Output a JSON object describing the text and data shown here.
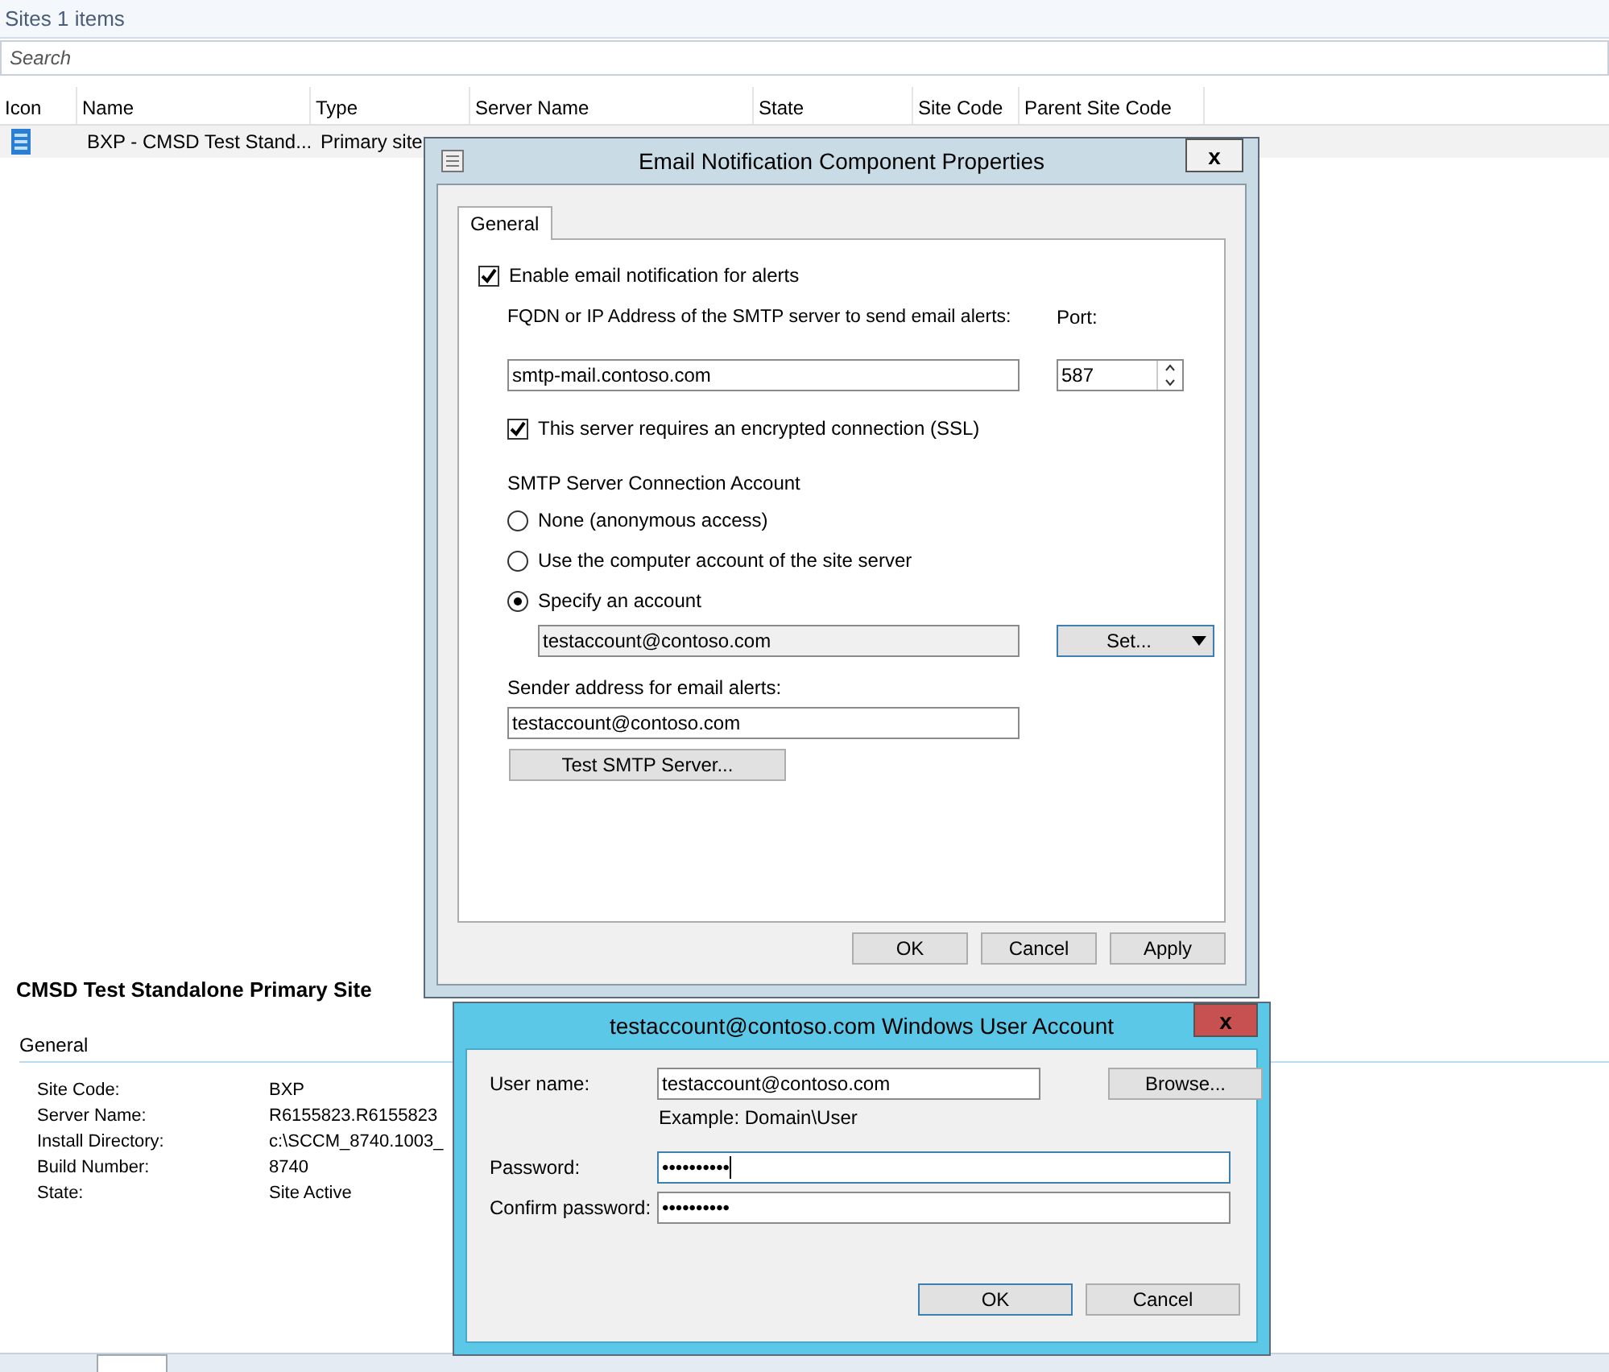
{
  "list_view": {
    "title": "Sites 1 items",
    "search": {
      "placeholder": "Search"
    },
    "columns": [
      "Icon",
      "Name",
      "Type",
      "Server Name",
      "State",
      "Site Code",
      "Parent Site Code"
    ],
    "rows": [
      {
        "cells": [
          "",
          "BXP - CMSD Test Stand...",
          "Primary site"
        ]
      }
    ]
  },
  "details": {
    "title": "CMSD Test Standalone Primary Site",
    "section": "General",
    "properties": [
      {
        "label": "Site Code:",
        "value": "BXP"
      },
      {
        "label": "Server Name:",
        "value": "R6155823.R6155823"
      },
      {
        "label": "Install Directory:",
        "value": "c:\\SCCM_8740.1003_"
      },
      {
        "label": "Build Number:",
        "value": "8740"
      },
      {
        "label": "State:",
        "value": "Site Active"
      }
    ]
  },
  "email_dialog": {
    "title": "Email Notification Component Properties",
    "close": "x",
    "tabs": [
      {
        "label": "General",
        "selected": true
      }
    ],
    "enable_checkbox": {
      "label": "Enable email notification for alerts",
      "checked": true
    },
    "server_label": "FQDN or IP Address of the SMTP server to send email alerts:",
    "port_label": "Port:",
    "server": "smtp-mail.contoso.com",
    "port": "587",
    "ssl_checkbox": {
      "label": "This server requires an encrypted connection (SSL)",
      "checked": true
    },
    "account_heading": "SMTP Server Connection Account",
    "account_options": [
      {
        "label": "None (anonymous access)",
        "selected": false
      },
      {
        "label": "Use the computer account of the site server",
        "selected": false
      },
      {
        "label": "Specify an account",
        "selected": true
      }
    ],
    "account": "testaccount@contoso.com",
    "set_button": "Set...",
    "sender_label": "Sender address for email alerts:",
    "sender": "testaccount@contoso.com",
    "test_button": "Test SMTP Server...",
    "buttons": [
      "OK",
      "Cancel",
      "Apply"
    ]
  },
  "account_dialog": {
    "title": "testaccount@contoso.com Windows User Account",
    "close": "x",
    "user_label": "User name:",
    "user": "testaccount@contoso.com",
    "browse_button": "Browse...",
    "example": "Example: Domain\\User",
    "password_label": "Password:",
    "password": "••••••••••",
    "password_focused": true,
    "confirm_label": "Confirm password:",
    "confirm": "••••••••••",
    "confirm_focused": false,
    "buttons": [
      "OK",
      "Cancel"
    ]
  }
}
